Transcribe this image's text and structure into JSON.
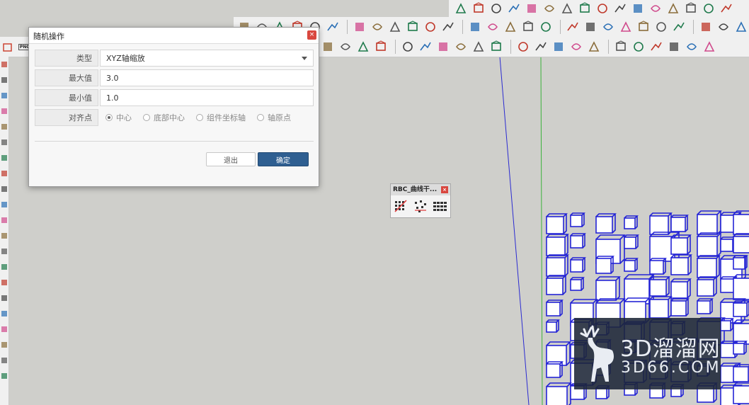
{
  "dialog": {
    "title": "随机操作",
    "close_label": "×",
    "rows": {
      "type_label": "类型",
      "type_value": "XYZ轴缩放",
      "max_label": "最大值",
      "max_value": "3.0",
      "min_label": "最小值",
      "min_value": "1.0",
      "align_label": "对齐点",
      "align_options": [
        "中心",
        "底部中心",
        "组件坐标轴",
        "轴原点"
      ],
      "align_selected": "中心"
    },
    "cancel_label": "退出",
    "ok_label": "确定"
  },
  "floating_toolbar": {
    "title": "RBC_曲线干...",
    "close_label": "×"
  },
  "left_toolbar_label": "PNG",
  "watermark": {
    "line1": "3D溜溜网",
    "line2": "3D66.COM"
  },
  "colors": {
    "viewport_bg": "#cfcfcb",
    "blue_axis": "#2b2bd1",
    "green_axis": "#3bb23b",
    "ok_button": "#2f5f91",
    "close_button": "#d9473f"
  }
}
